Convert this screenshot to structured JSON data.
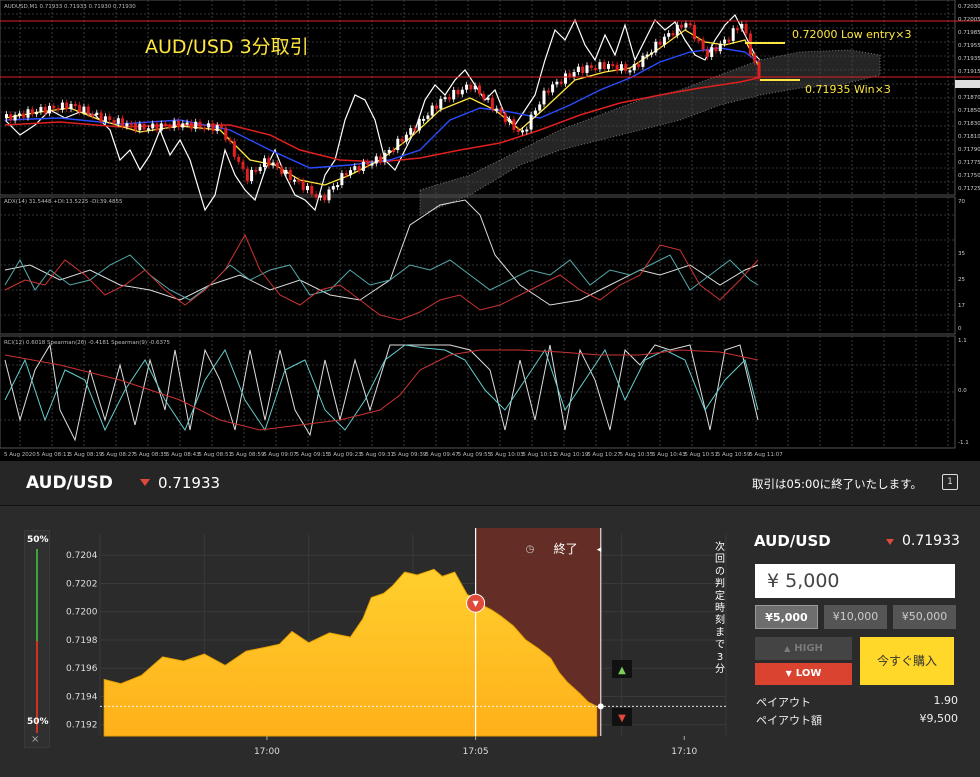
{
  "mt4": {
    "header": "AUDUSD,M1  0.71933 0.71933 0.71930 0.71930",
    "title_overlay": "AUD/USD  3分取引",
    "entry_note": "0.72000  Low entry×3",
    "win_note": "0.71935  Win×3",
    "adx_header": "ADX(14) 31.5448 +DI:13.5225 -DI:39.4855",
    "rci_header": "RCI(12) 0.6018  Spearman(26) -0.4181  Spearman(9) -0.6375",
    "price_ticks": [
      "0.72030",
      "0.72005",
      "0.71985",
      "0.71955",
      "0.71935",
      "0.71915",
      "0.71890",
      "0.71870",
      "0.71850",
      "0.71830",
      "0.71810",
      "0.71790",
      "0.71775",
      "0.71750",
      "0.71725"
    ],
    "adx_ticks": [
      "70",
      "35",
      "25",
      "17",
      "0"
    ],
    "rci_ticks": [
      "1.1",
      "0.0",
      "-1.1"
    ],
    "time_ticks": [
      "5 Aug 2020",
      "5 Aug 08:11",
      "5 Aug 08:19",
      "5 Aug 08:27",
      "5 Aug 08:35",
      "5 Aug 08:43",
      "5 Aug 08:51",
      "5 Aug 08:59",
      "5 Aug 09:07",
      "5 Aug 09:15",
      "5 Aug 09:23",
      "5 Aug 09:31",
      "5 Aug 09:39",
      "5 Aug 09:47",
      "5 Aug 09:55",
      "5 Aug 10:03",
      "5 Aug 10:11",
      "5 Aug 10:19",
      "5 Aug 10:27",
      "5 Aug 10:35",
      "5 Aug 10:43",
      "5 Aug 10:51",
      "5 Aug 10:59",
      "5 Aug 11:07"
    ]
  },
  "topbar": {
    "symbol": "AUD/USD",
    "price": "0.71933",
    "message": "取引は05:00に終了いたします。",
    "icon_label": "1"
  },
  "gauge": {
    "top": "50%",
    "bottom": "50%",
    "close": "×"
  },
  "chart_data": {
    "type": "area",
    "title": "",
    "y_ticks": [
      "0.7204",
      "0.7202",
      "0.7200",
      "0.7198",
      "0.7196",
      "0.7194",
      "0.7192"
    ],
    "ylim": [
      0.71912,
      0.72055
    ],
    "x_ticks": [
      "17:00",
      "17:05",
      "17:10"
    ],
    "x_minutes": [
      0,
      5,
      10
    ],
    "x": [
      -3.9,
      -3.5,
      -3.0,
      -2.5,
      -2.0,
      -1.5,
      -1.0,
      -0.5,
      0.0,
      0.3,
      0.6,
      1.0,
      1.5,
      2.0,
      2.3,
      2.5,
      2.8,
      3.0,
      3.3,
      3.6,
      4.0,
      4.2,
      4.5,
      4.8,
      5.0,
      5.2,
      5.4,
      5.6,
      5.9,
      6.2,
      6.5,
      6.8,
      7.0,
      7.2,
      7.5,
      7.7,
      7.9
    ],
    "values": [
      0.71952,
      0.71949,
      0.71955,
      0.71968,
      0.71965,
      0.7197,
      0.71962,
      0.71972,
      0.71975,
      0.71977,
      0.71986,
      0.71978,
      0.71985,
      0.71982,
      0.71995,
      0.7201,
      0.72013,
      0.72018,
      0.72028,
      0.72026,
      0.7203,
      0.72025,
      0.72028,
      0.72012,
      0.7201,
      0.72004,
      0.72001,
      0.71997,
      0.7199,
      0.7198,
      0.71974,
      0.71967,
      0.71957,
      0.7195,
      0.71942,
      0.71936,
      0.71933
    ],
    "entry_minute": 5.0,
    "end_minute": 8.0,
    "current_price_line": 0.71933,
    "end_label": "終了",
    "countdown_label": "次回の判定時刻まで3分"
  },
  "panel": {
    "symbol": "AUD/USD",
    "price": "0.71933",
    "amount": "¥ 5,000",
    "presets": [
      "¥5,000",
      "¥10,000",
      "¥50,000"
    ],
    "high_label": "HIGH",
    "low_label": "LOW",
    "buy_label": "今すぐ購入",
    "payout_label": "ペイアウト",
    "payout_value": "1.90",
    "payout_amount_label": "ペイアウト額",
    "payout_amount_value": "¥9,500"
  },
  "colors": {
    "accent_yellow": "#ffd82a",
    "low_red": "#d9432f",
    "high_gray": "#444444"
  }
}
